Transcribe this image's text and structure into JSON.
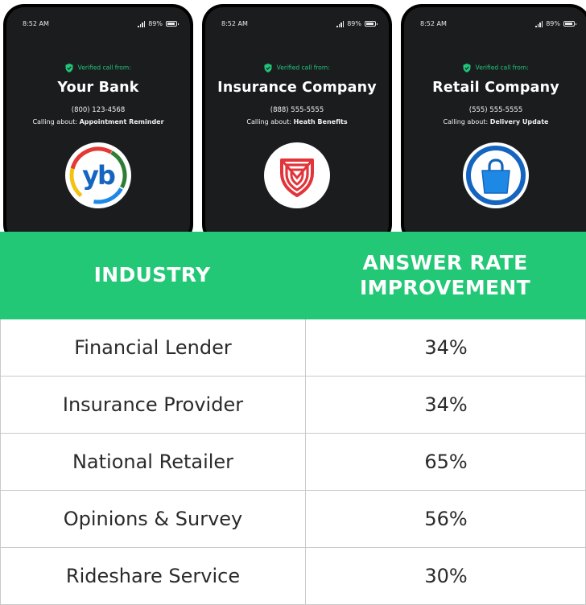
{
  "phones": [
    {
      "time": "8:52 AM",
      "battery": "89%",
      "verified_label": "Verified call from:",
      "name": "Your Bank",
      "number": "(800) 123-4568",
      "calling_about_label": "Calling about:",
      "calling_about": "Appointment Reminder",
      "logo_text": "yb",
      "logo": "yb-bank-logo"
    },
    {
      "time": "8:52 AM",
      "battery": "89%",
      "verified_label": "Verified call from:",
      "name": "Insurance Company",
      "number": "(888) 555-5555",
      "calling_about_label": "Calling about:",
      "calling_about": "Heath Benefits",
      "logo": "shield-icon"
    },
    {
      "time": "8:52 AM",
      "battery": "89%",
      "verified_label": "Verified call from:",
      "name": "Retail Company",
      "number": "(555) 555-5555",
      "calling_about_label": "Calling about:",
      "calling_about": "Delivery Update",
      "logo": "shopping-bag-icon"
    }
  ],
  "table": {
    "headers": {
      "industry": "INDUSTRY",
      "rate_line1": "ANSWER RATE",
      "rate_line2": "IMPROVEMENT"
    },
    "rows": [
      {
        "industry": "Financial Lender",
        "rate": "34%"
      },
      {
        "industry": "Insurance Provider",
        "rate": "34%"
      },
      {
        "industry": "National Retailer",
        "rate": "65%"
      },
      {
        "industry": "Opinions & Survey",
        "rate": "56%"
      },
      {
        "industry": "Rideshare Service",
        "rate": "30%"
      }
    ]
  },
  "colors": {
    "header_green": "#22c876",
    "verified_green": "#20c57a",
    "phone_screen": "#1b1c1e",
    "shield_red": "#e2343a",
    "bag_blue": "#1e88e5"
  }
}
